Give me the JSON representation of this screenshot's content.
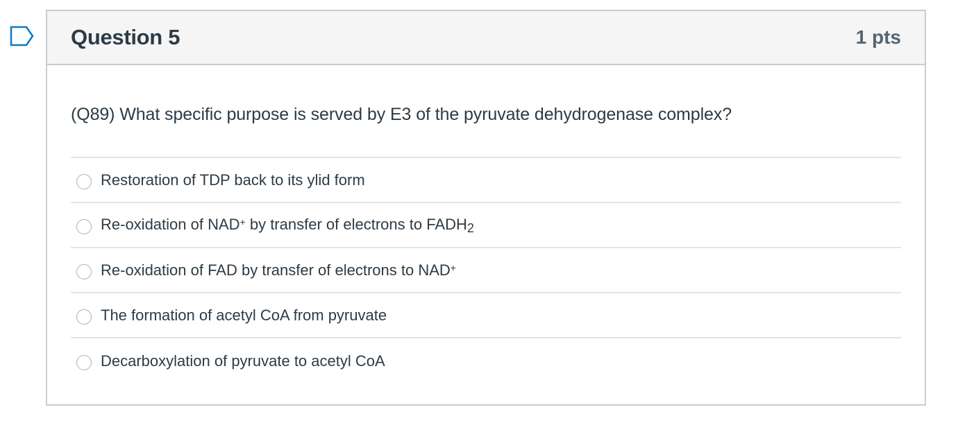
{
  "flag": {
    "icon": "bookmark-flag-icon"
  },
  "question": {
    "title": "Question 5",
    "points": "1 pts",
    "text": "(Q89) What specific purpose is served by E3 of the pyruvate dehydrogenase complex?"
  },
  "answers": [
    {
      "label": "Restoration of TDP back to its ylid form"
    },
    {
      "label_pre": "Re-oxidation of NAD",
      "label_sup": "+",
      "label_mid": " by transfer of electrons to FADH",
      "label_sub": "2"
    },
    {
      "label_pre": "Re-oxidation of FAD by transfer of electrons to NAD",
      "label_sup": "+"
    },
    {
      "label": "The formation of acetyl CoA from pyruvate"
    },
    {
      "label": "Decarboxylation of pyruvate to acetyl CoA"
    }
  ],
  "colors": {
    "header_bg": "#f5f5f5",
    "border": "#c7cdd1",
    "text": "#2d3b45",
    "flag_stroke": "#0a7ac4"
  }
}
